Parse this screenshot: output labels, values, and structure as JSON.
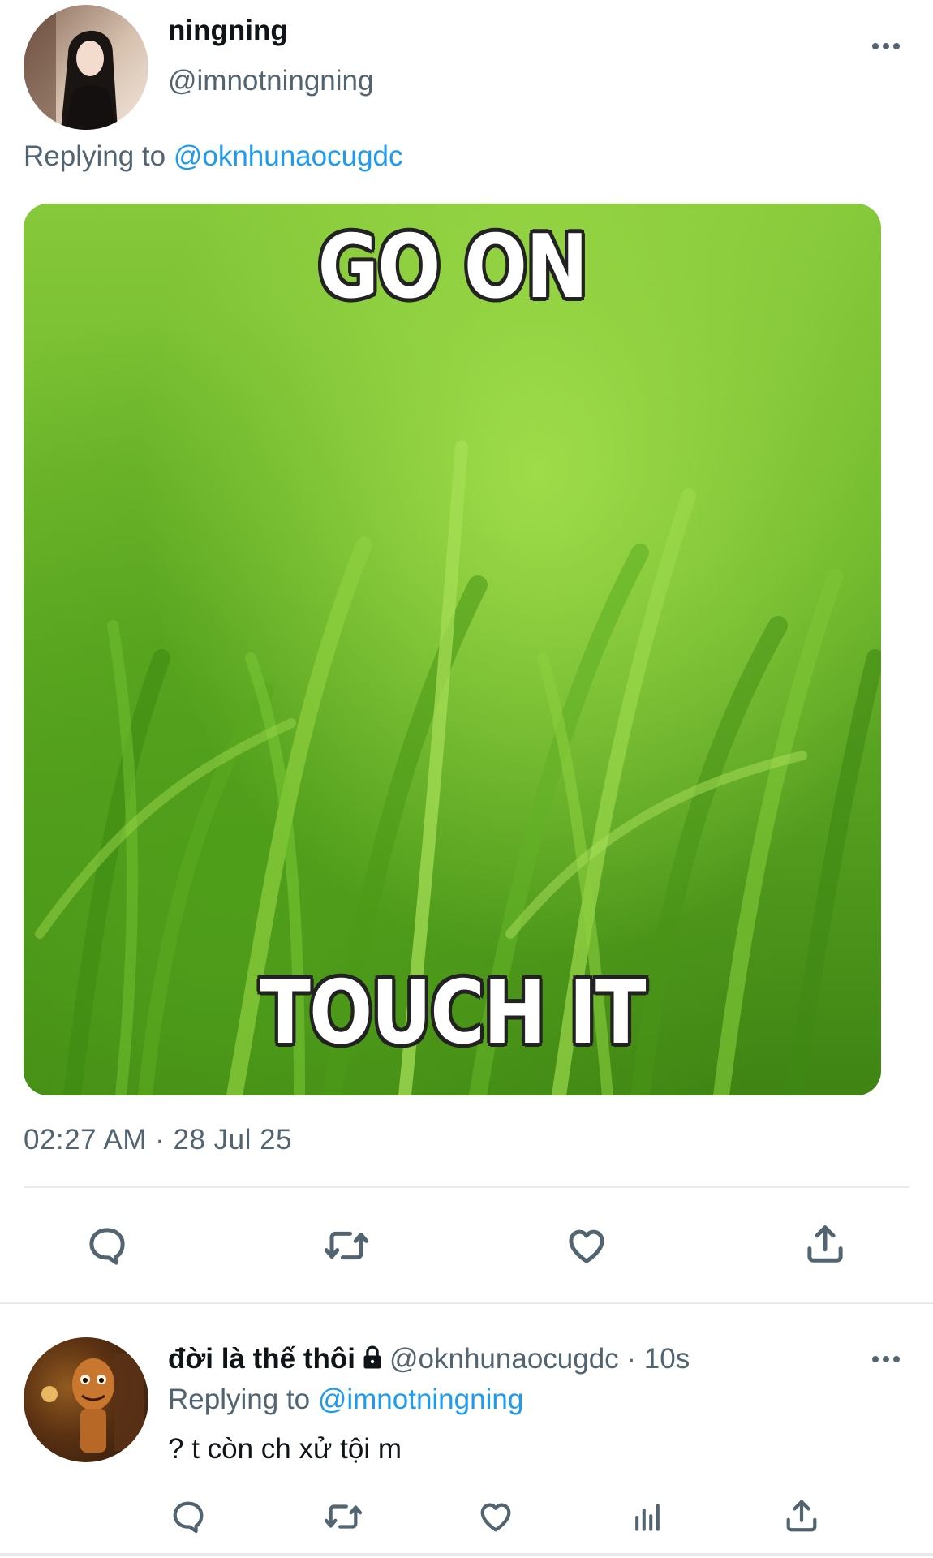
{
  "tweet": {
    "display_name": "ningning",
    "handle": "@imnotningning",
    "replying_prefix": "Replying to ",
    "replying_to": "@oknhunaocugdc",
    "media": {
      "top_text": "GO ON",
      "bottom_text": "TOUCH IT"
    },
    "timestamp": "02:27 AM · 28 Jul 25",
    "actions": [
      "reply-icon",
      "retweet-icon",
      "like-icon",
      "share-icon"
    ]
  },
  "reply": {
    "display_name": "đời là thế thôi",
    "handle": "@oknhunaocugdc",
    "separator": " · ",
    "time": "10s",
    "replying_prefix": "Replying to ",
    "replying_to": "@imnotningning",
    "text": "? t còn ch xử tội m",
    "actions": [
      "reply-icon",
      "retweet-icon",
      "like-icon",
      "views-icon",
      "share-icon"
    ]
  },
  "colors": {
    "link": "#1d9bf0",
    "secondary_text": "#536471",
    "divider": "#e7e9ea"
  }
}
